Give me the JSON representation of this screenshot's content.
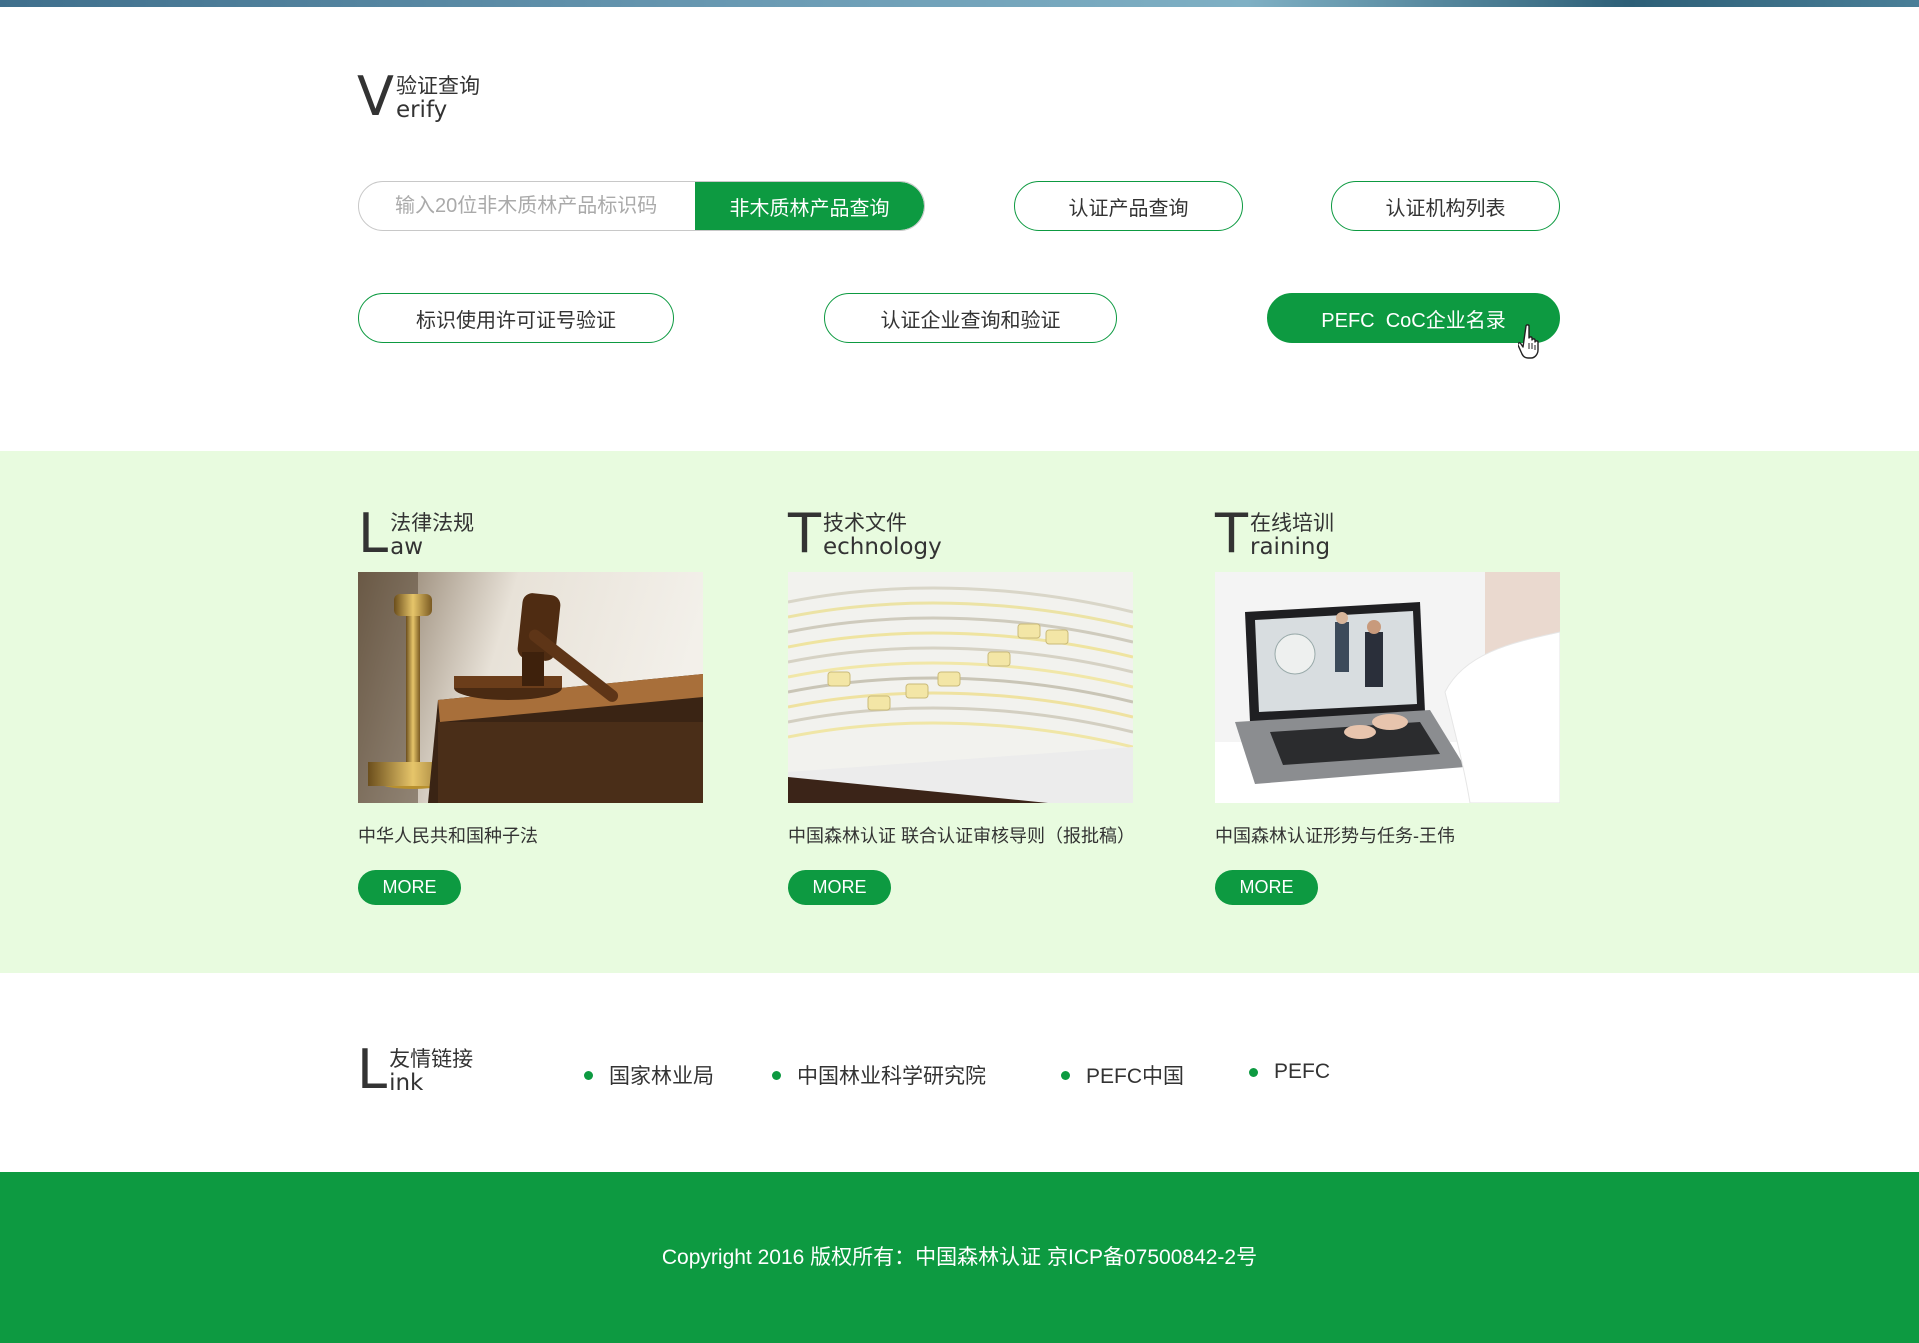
{
  "verify": {
    "big_letter": "V",
    "title_cn": "验证查询",
    "title_en": "erify",
    "search_placeholder": "输入20位非木质林产品标识码",
    "search_button": "非木质林产品查询",
    "btn_cert_product": "认证产品查询",
    "btn_cert_body_list": "认证机构列表",
    "btn_label_license": "标识使用许可证号验证",
    "btn_cert_company": "认证企业查询和验证",
    "btn_pefc_coc": "PEFC  CoC企业名录"
  },
  "columns": [
    {
      "big_letter": "L",
      "title_cn": "法律法规",
      "title_en": "aw",
      "image_icon": "gavel-photo",
      "caption": "中华人民共和国种子法",
      "more": "MORE"
    },
    {
      "big_letter": "T",
      "title_cn": "技术文件",
      "title_en": "echnology",
      "image_icon": "file-tabs-photo",
      "caption": "中国森林认证 联合认证审核导则（报批稿）",
      "more": "MORE"
    },
    {
      "big_letter": "T",
      "title_cn": "在线培训",
      "title_en": "raining",
      "image_icon": "laptop-training-photo",
      "caption": "中国森林认证形势与任务-王伟",
      "more": "MORE"
    }
  ],
  "links": {
    "big_letter": "L",
    "title_cn": "友情链接",
    "title_en": "ink",
    "items": [
      "国家林业局",
      "中国林业科学研究院",
      "PEFC中国",
      "PEFC"
    ]
  },
  "footer": {
    "text": "Copyright 2016 版权所有：中国森林认证 京ICP备07500842-2号"
  },
  "colors": {
    "brand_green": "#0d9a41",
    "band_bg": "#e8fbdf"
  }
}
